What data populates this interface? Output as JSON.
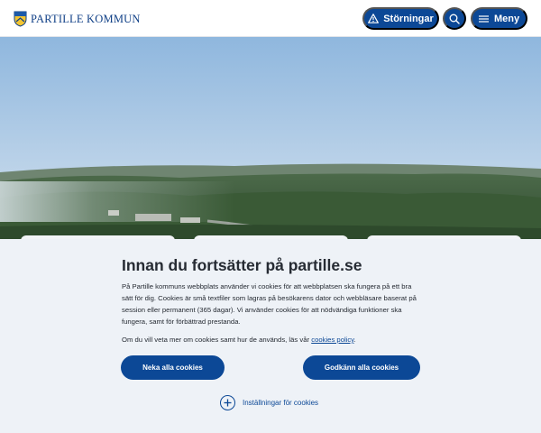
{
  "header": {
    "logo_text": "PARTILLE KOMMUN",
    "disruptions_label": "Störningar",
    "menu_label": "Meny"
  },
  "consent": {
    "title": "Innan du fortsätter på partille.se",
    "body": "På Partille kommuns webbplats använder vi cookies för att webbplatsen ska fungera på ett bra sätt för dig. Cookies är små textfiler som lagras på besökarens dator och webbläsare baserat på session eller permanent (365 dagar). Vi använder cookies för att nödvändiga funktioner ska fungera, samt för förbättrad prestanda.",
    "more_prefix": "Om du vill veta mer om cookies samt hur de används, läs vår ",
    "more_link": "cookies policy",
    "more_suffix": ".",
    "deny_label": "Neka alla cookies",
    "accept_label": "Godkänn alla cookies",
    "settings_label": "Inställningar för cookies"
  },
  "colors": {
    "brand": "#0c4896",
    "panel_bg": "#eef2f7",
    "text": "#262b33"
  },
  "icons": {
    "logo": "partille-coat-of-arms",
    "disruptions": "warning-triangle-icon",
    "search": "search-icon",
    "menu": "hamburger-icon",
    "settings": "plus-circle-icon"
  }
}
